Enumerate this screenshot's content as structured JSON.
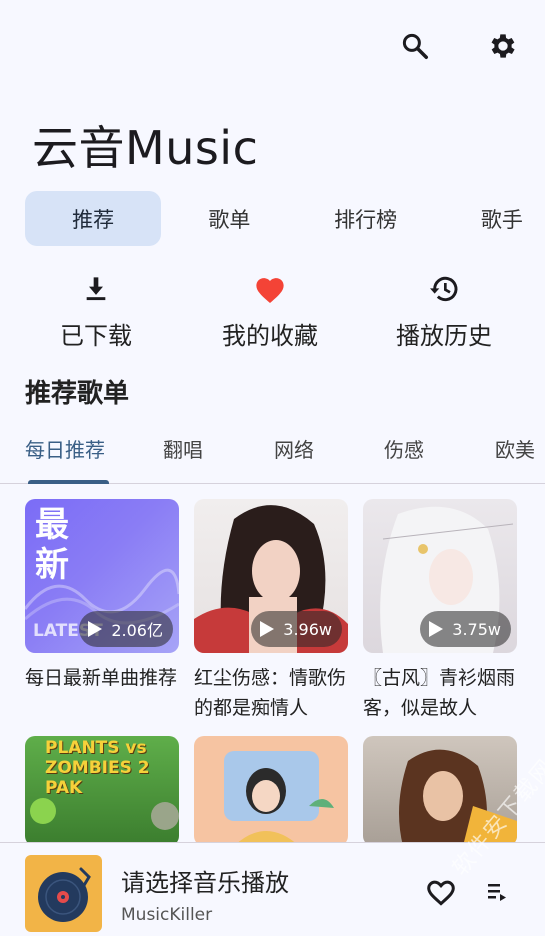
{
  "header": {
    "title": "云音Music",
    "icons": [
      "search-icon",
      "settings-icon"
    ]
  },
  "tabs": [
    {
      "label": "推荐",
      "active": true
    },
    {
      "label": "歌单"
    },
    {
      "label": "排行榜"
    },
    {
      "label": "歌手"
    }
  ],
  "shortcuts": [
    {
      "label": "已下载",
      "icon": "download-icon"
    },
    {
      "label": "我的收藏",
      "icon": "heart-icon",
      "color": "#f44336"
    },
    {
      "label": "播放历史",
      "icon": "history-icon"
    }
  ],
  "section_title": "推荐歌单",
  "subtabs": [
    {
      "label": "每日推荐",
      "active": true
    },
    {
      "label": "翻唱"
    },
    {
      "label": "网络"
    },
    {
      "label": "伤感"
    },
    {
      "label": "欧美"
    }
  ],
  "playlists": [
    {
      "title": "每日最新单曲推荐",
      "plays": "2.06亿",
      "cover_text": "最新",
      "cover_sub": "LATEST"
    },
    {
      "title": "红尘伤感：情歌伤的都是痴情人",
      "plays": "3.96w"
    },
    {
      "title": "〖古风〗青衫烟雨客，似是故人",
      "plays": "3.75w"
    },
    {
      "title": "",
      "cover_text": "PLANTS vs ZOMBIES 2 PAK"
    },
    {
      "title": ""
    },
    {
      "title": ""
    }
  ],
  "player": {
    "song": "请选择音乐播放",
    "artist": "MusicKiller",
    "icons": [
      "heart-outline-icon",
      "queue-icon"
    ]
  },
  "watermark": "软件安下载网",
  "colors": {
    "accent": "#3a5f86",
    "tab_active_bg": "#d7e3f7",
    "heart": "#f44336"
  }
}
